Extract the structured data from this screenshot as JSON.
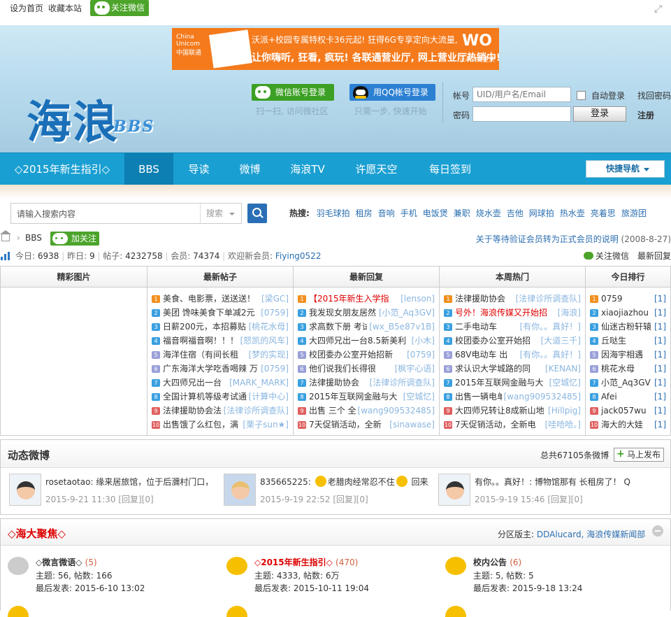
{
  "topbar": {
    "set_home": "设为首页",
    "bookmark": "收藏本站",
    "follow_wechat": "关注微信"
  },
  "ad": {
    "carrier": "China Unicom 中国联通",
    "line1": "沃派+校园专属特权卡36元起! 狂得6G专享定向大流量,",
    "line2": "让你嗨听, 狂看, 疯玩! 各联通营业厅, 网上营业厅热销中!",
    "brand": "WO",
    "tag": "沃4G 神速沃"
  },
  "logo": {
    "main": "海浪",
    "sub": "BBS"
  },
  "login": {
    "wechat_btn": "微信账号登录",
    "wechat_tip": "扫一扫, 访问微社区",
    "qq_btn": "用QQ帐号登录",
    "qq_tip": "只需一步, 快速开始",
    "account_label": "帐号",
    "account_placeholder": "UID/用户名/Email",
    "auto_login": "自动登录",
    "forgot": "找回密码",
    "password_label": "密码",
    "login_btn": "登录",
    "register": "注册"
  },
  "nav": {
    "items": [
      "◇2015年新生指引◇",
      "BBS",
      "导读",
      "微博",
      "海浪TV",
      "许愿天空",
      "每日签到"
    ],
    "active": 1,
    "quick": "快捷导航"
  },
  "search": {
    "placeholder": "请输入搜索内容",
    "type": "搜索",
    "hot_label": "热搜:",
    "hot": [
      "羽毛球拍",
      "租房",
      "音响",
      "手机",
      "电饭煲",
      "兼职",
      "烧水壶",
      "吉他",
      "网球拍",
      "热水壶",
      "亮着思",
      "旅游团"
    ]
  },
  "crumb": {
    "bbs": "BBS",
    "follow": "加关注",
    "notice_title": "关于等待验证会员转为正式会员的说明",
    "notice_date": "(2008-8-27)"
  },
  "stats": {
    "today_label": "今日:",
    "today": "6938",
    "yesterday_label": "昨日:",
    "yesterday": "9",
    "posts_label": "帖子:",
    "posts": "4232758",
    "members_label": "会员:",
    "members": "74374",
    "welcome_label": "欢迎新会员:",
    "newest": "Fiying0522",
    "follow_wechat": "关注微信",
    "latest_reply": "最新回复"
  },
  "grid": {
    "headers": [
      "精彩图片",
      "最新帖子",
      "最新回复",
      "本周热门",
      "今日排行"
    ],
    "new_posts": [
      {
        "t": "美食、电影票，送送送！",
        "a": "[梁GC]"
      },
      {
        "t": "美团 馋味美食下单减2元",
        "a": "[0759]"
      },
      {
        "t": "日薪200元，本招募贴",
        "a": "[桃花水母]"
      },
      {
        "t": "福音啊福音啊！！！",
        "a": "[怒凯的风车]"
      },
      {
        "t": "海洋住宿（有间长租",
        "a": "[梦的实现]"
      },
      {
        "t": "广东海洋大学吃香喝辣 万",
        "a": "[0759]"
      },
      {
        "t": "大四师兄出一台",
        "a": "[MARK_MARK]"
      },
      {
        "t": "全国计算机等级考试通",
        "a": "[计算中心]"
      },
      {
        "t": "法律援助协会法",
        "a": "[法律诊所调查队]"
      },
      {
        "t": "出售饿了么红包，满",
        "a": "[栗子sun★]"
      }
    ],
    "new_replies": [
      {
        "t": "【2015年新生入学指",
        "a": "[lenson]",
        "red": true
      },
      {
        "t": "我发现女朋友居然",
        "a": "[小范_Aq3GV]"
      },
      {
        "t": "求高数下册 考试",
        "a": "[wx_B5e87v1B]"
      },
      {
        "t": "大四师兄出一台8.5新美利",
        "a": "[小木]"
      },
      {
        "t": "校团委办公室开始招新",
        "a": "[0759]"
      },
      {
        "t": "他们说我们长得很",
        "a": "[枫宇心语]"
      },
      {
        "t": "法律援助协会",
        "a": "[法律诊所调查队]"
      },
      {
        "t": "2015年互联网金融与大",
        "a": "[空城忆]"
      },
      {
        "t": "出售 三个 全",
        "a": "[wang909532485]"
      },
      {
        "t": "7天促销活动，全新",
        "a": "[sinawase]"
      }
    ],
    "weekly_hot": [
      {
        "t": "法律援助协会",
        "a": "[法律诊所调查队]"
      },
      {
        "t": "号外！海浪传媒又开始招",
        "a": "[海浪]",
        "red": true
      },
      {
        "t": "二手电动车",
        "a": "[有你。。真好！]"
      },
      {
        "t": "校团委办公室开始招",
        "a": "[大道三千]"
      },
      {
        "t": "68V电动车 出",
        "a": "[有你。。真好！]"
      },
      {
        "t": "求认识大学城路的同",
        "a": "[KENAN]"
      },
      {
        "t": "2015年互联网金融与大",
        "a": "[空城忆]"
      },
      {
        "t": "出售一辆电单车",
        "a": "[wang909532485]"
      },
      {
        "t": "大四师兄转让8成新山地",
        "a": "[Hillpig]"
      },
      {
        "t": "7天促销活动，全新电",
        "a": "[哇哈哈。]"
      }
    ],
    "today_rank": [
      {
        "t": "0759",
        "c": "[1]"
      },
      {
        "t": "xiaojiazhou",
        "c": "[1]"
      },
      {
        "t": "仙迷古粉轩辕",
        "c": "[1]"
      },
      {
        "t": "丘哒生",
        "c": "[1]"
      },
      {
        "t": "因海宇相遇",
        "c": "[1]"
      },
      {
        "t": "桃花水母",
        "c": "[1]"
      },
      {
        "t": "小范_Aq3GV",
        "c": "[1]"
      },
      {
        "t": "Afei",
        "c": "[1]"
      },
      {
        "t": "jack057wu",
        "c": "[1]"
      },
      {
        "t": "海大的大娃",
        "c": "[1]"
      }
    ]
  },
  "weibo": {
    "title": "动态微博",
    "count": "总共67105条微博",
    "publish": "马上发布",
    "items": [
      {
        "text": "rosetaotao: 缘来居旅馆，位于后瀰村门口，",
        "time": "2015-9-21 11:30 [回复][0]"
      },
      {
        "text": "835665225:",
        "text2": "老腊肉经常忍不住",
        "text3": "回来",
        "time": "2015-9-19 22:52 [回复][0]"
      },
      {
        "text": "有你。。真好！: 博物馆那有 长租房了！ Q",
        "time": "2015-9-19 15:46 [回复][0]"
      }
    ]
  },
  "zone": {
    "title": "◇海大聚焦◇",
    "mod_label": "分区版主:",
    "mods": "DDAlucard, 海浪传媒新闻部",
    "forums": [
      {
        "name": "◇微言微语◇",
        "today": "(5)",
        "stats": "主题: 56, 帖数: 166",
        "last": "最后发表: 2015-6-10 13:02"
      },
      {
        "name": "◇2015年新生指引◇",
        "today": "(470)",
        "stats": "主题: 4333, 帖数: 6万",
        "last": "最后发表: 2015-10-11 19:04",
        "red": true
      },
      {
        "name": "校内公告",
        "today": "(6)",
        "stats": "主题: 5, 帖数: 5",
        "last": "最后发表: 2015-9-18 13:24"
      }
    ]
  }
}
